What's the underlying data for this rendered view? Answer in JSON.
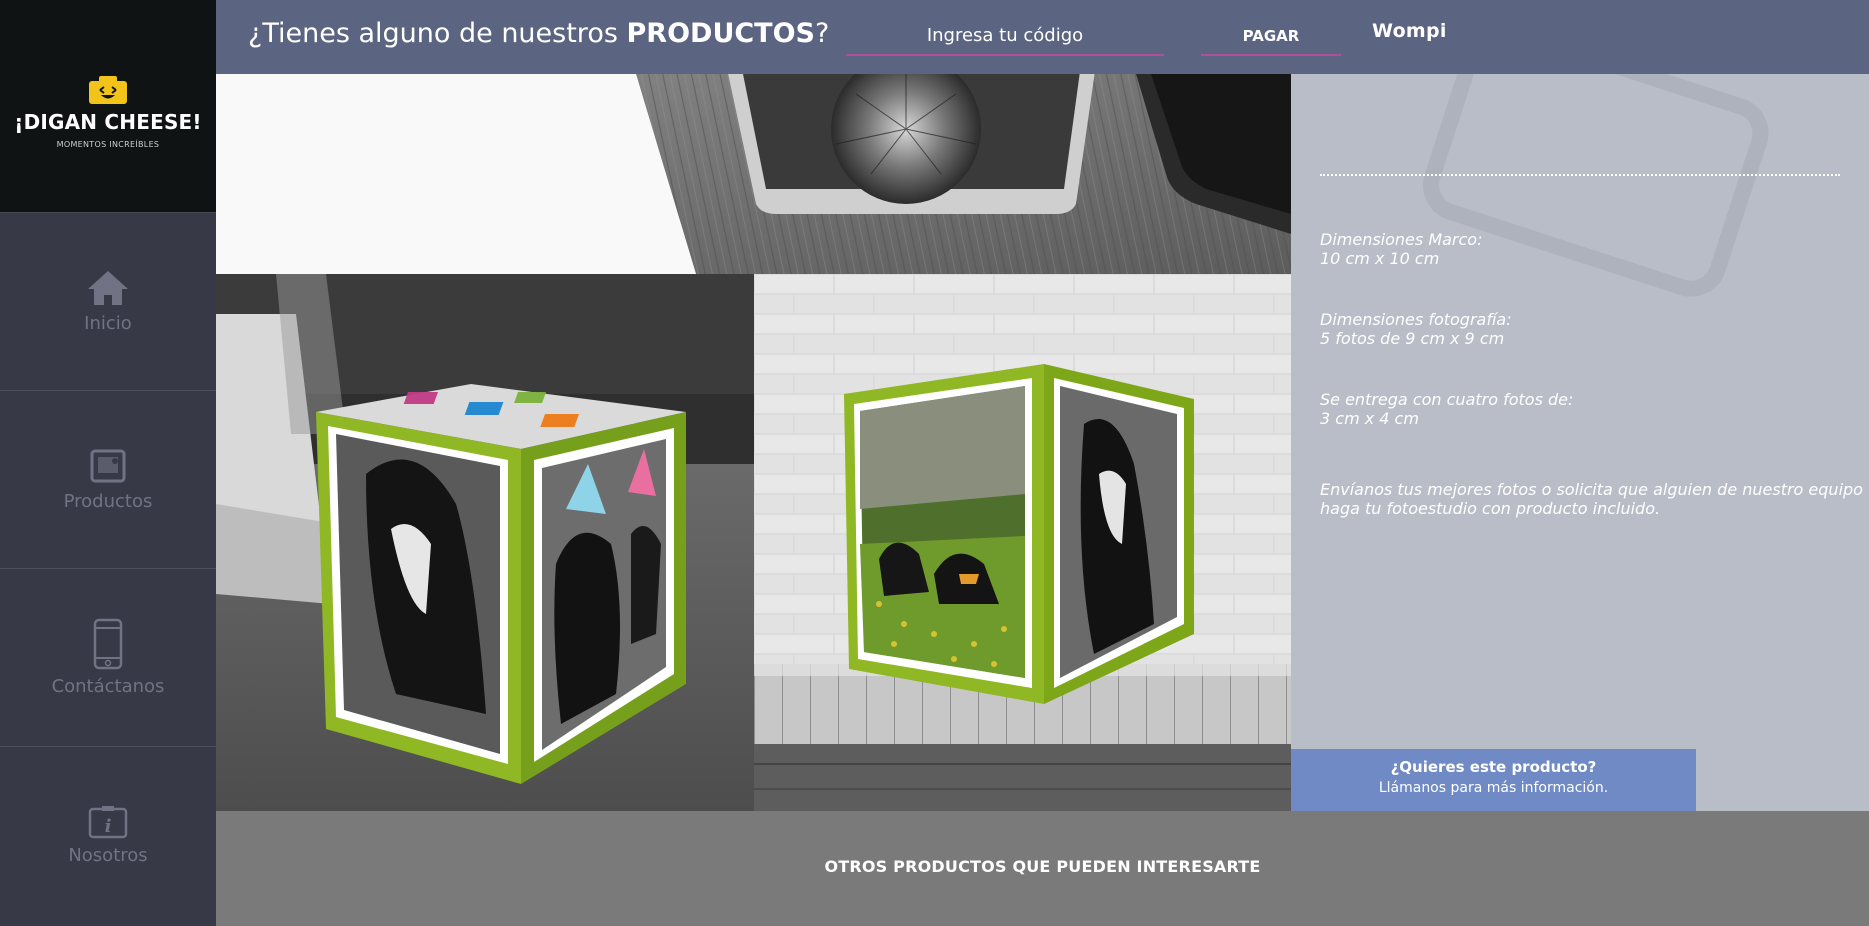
{
  "brand": {
    "name": "¡DIGAN CHEESE!",
    "tagline": "MOMENTOS INCREÍBLES",
    "accent": "#f2c318"
  },
  "sidebar": {
    "items": [
      {
        "label": "Inicio",
        "icon": "home-icon"
      },
      {
        "label": "Productos",
        "icon": "photos-icon"
      },
      {
        "label": "Contáctanos",
        "icon": "phone-icon"
      },
      {
        "label": "Nosotros",
        "icon": "info-icon"
      }
    ]
  },
  "header": {
    "question_start": "¿Tienes alguno de nuestros ",
    "question_bold": "PRODUCTOS",
    "question_end": "?",
    "code_placeholder": "Ingresa tu código",
    "pay_label": "PAGAR",
    "payment_brand": "Wompi",
    "accent": "#b04f9c"
  },
  "product": {
    "specs": [
      {
        "title": "Dimensiones Marco:",
        "value": "10 cm x 10 cm"
      },
      {
        "title": "Dimensiones fotografía:",
        "value": "5 fotos de 9 cm x 9 cm"
      },
      {
        "title": "Se entrega con cuatro fotos de:",
        "value": "3 cm x 4 cm"
      }
    ],
    "note_line1": "Envíanos tus mejores fotos o solicita que alguien de nuestro equipo",
    "note_line2": "haga tu fotoestudio con producto incluido."
  },
  "cta": {
    "title": "¿Quieres este producto?",
    "subtitle": "Llámanos para más información."
  },
  "footer": {
    "title": "OTROS PRODUCTOS QUE PUEDEN INTERESARTE"
  }
}
